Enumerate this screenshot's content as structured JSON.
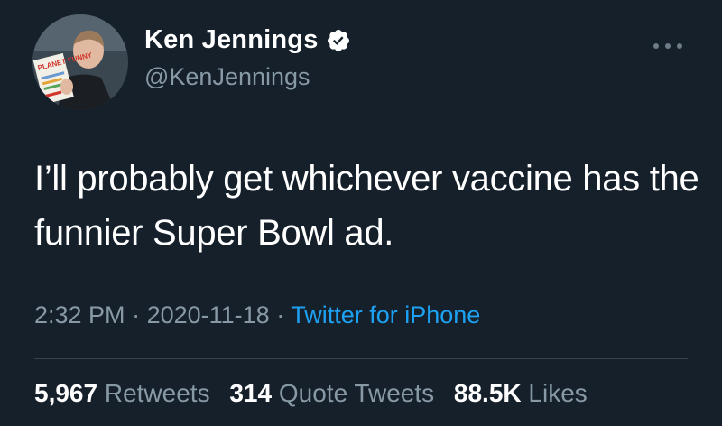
{
  "author": {
    "display_name": "Ken Jennings",
    "handle": "@KenJennings",
    "verified": true,
    "avatar_book_text": "PLANET FUNNY"
  },
  "tweet": {
    "text": "I’ll probably get whichever vaccine has the funnier Super Bowl ad.",
    "time": "2:32 PM",
    "date": "2020-11-18",
    "separator": "·",
    "source": "Twitter for iPhone"
  },
  "stats": {
    "retweets_count": "5,967",
    "retweets_label": "Retweets",
    "quotes_count": "314",
    "quotes_label": "Quote Tweets",
    "likes_count": "88.5K",
    "likes_label": "Likes"
  },
  "colors": {
    "background": "#15202b",
    "text": "#ffffff",
    "secondary_text": "#8899a6",
    "link": "#1da1f2",
    "verified_badge": "#ffffff"
  },
  "icons": {
    "verified": "verified-badge-icon",
    "more": "more-options-icon"
  }
}
